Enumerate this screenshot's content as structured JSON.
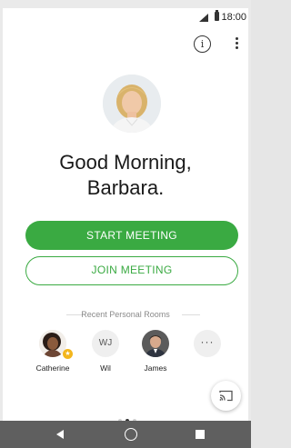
{
  "status_bar": {
    "time": "18:00"
  },
  "header": {
    "info_icon_glyph": "i"
  },
  "greeting": {
    "line1": "Good Morning,",
    "line2": "Barbara."
  },
  "actions": {
    "start_label": "START MEETING",
    "join_label": "JOIN MEETING"
  },
  "recent": {
    "title": "Recent Personal Rooms",
    "rooms": [
      {
        "name": "Catherine",
        "type": "photo",
        "favorite": true
      },
      {
        "name": "Wil",
        "type": "initials",
        "initials": "WJ"
      },
      {
        "name": "James",
        "type": "photo"
      },
      {
        "name": "",
        "type": "more",
        "glyph": "···"
      }
    ]
  },
  "pager": {
    "count": 3,
    "active_index": 1
  },
  "colors": {
    "accent": "#3aaa42",
    "navbar": "#5f5f5f",
    "favorite": "#f3b61d"
  }
}
